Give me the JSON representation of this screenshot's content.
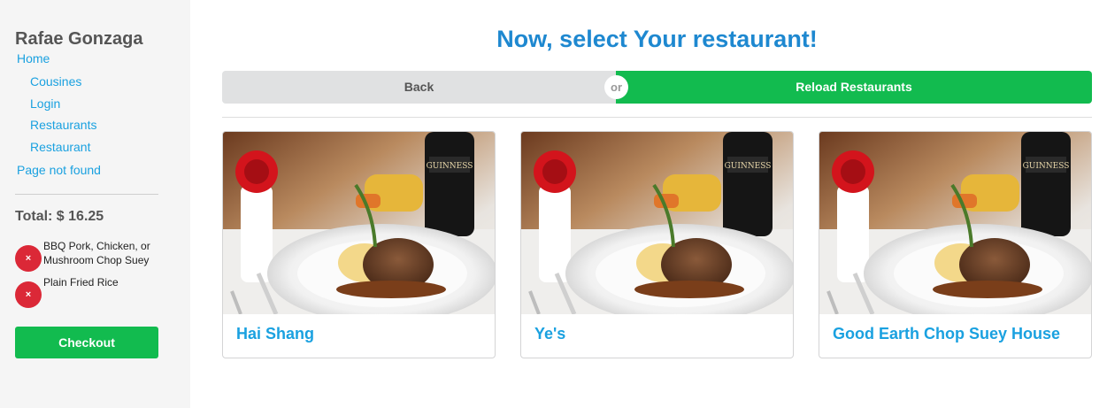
{
  "sidebar": {
    "user_name": "Rafae Gonzaga",
    "nav": [
      {
        "label": "Home"
      },
      {
        "label": "Cousines"
      },
      {
        "label": "Login"
      },
      {
        "label": "Restaurants"
      },
      {
        "label": "Restaurant"
      },
      {
        "label": "Page not found"
      }
    ],
    "total_label": "Total: $ 16.25",
    "cart_items": [
      {
        "name": "BBQ Pork, Chicken, or Mushroom Chop Suey",
        "remove_icon": "×"
      },
      {
        "name": "Plain Fried Rice",
        "remove_icon": "×"
      }
    ],
    "checkout_label": "Checkout"
  },
  "main": {
    "heading": "Now, select Your restaurant!",
    "back_label": "Back",
    "or_label": "or",
    "reload_label": "Reload Restaurants",
    "restaurants": [
      {
        "name": "Hai Shang"
      },
      {
        "name": "Ye's"
      },
      {
        "name": "Good Earth Chop Suey House"
      }
    ]
  },
  "colors": {
    "accent_blue": "#1e88d0",
    "link_blue": "#1aa1e0",
    "green": "#12bb4f",
    "red": "#db2837",
    "sidebar_bg": "#f5f5f5"
  },
  "icons": {
    "remove": "close-icon",
    "photo": "food-photo"
  }
}
